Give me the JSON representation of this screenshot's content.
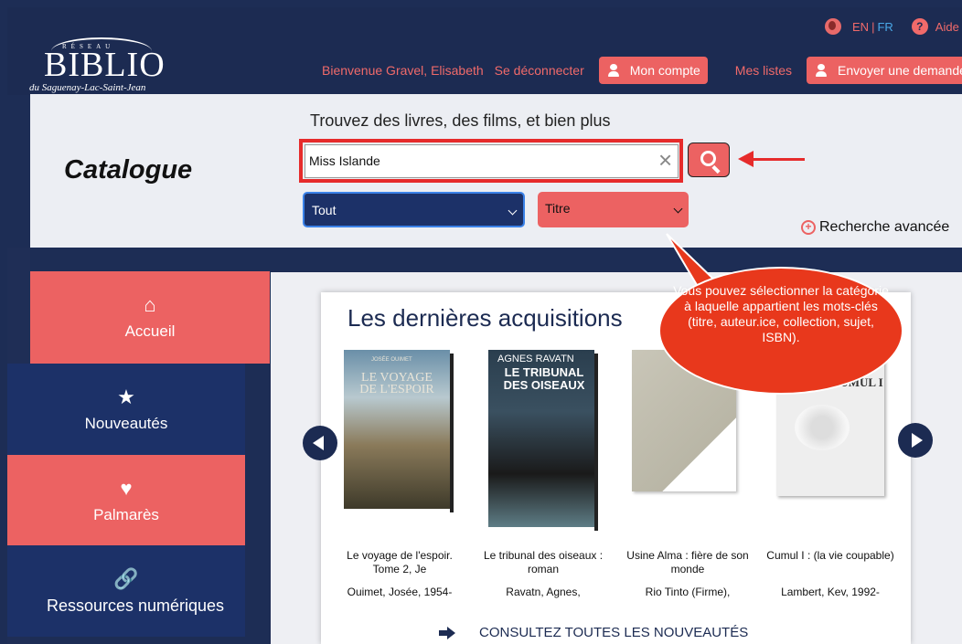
{
  "header": {
    "logo": {
      "reseau": "RÉSEAU",
      "name": "BIBLIO",
      "region": "du Saguenay-Lac-Saint-Jean"
    },
    "lang": {
      "en": "EN",
      "fr": "FR",
      "help": "Aide"
    },
    "welcome": "Bienvenue Gravel, Elisabeth",
    "logout": "Se déconnecter",
    "account": "Mon compte",
    "lists": "Mes listes",
    "request": "Envoyer une demande"
  },
  "search": {
    "page_title": "Catalogue",
    "tagline": "Trouvez des livres, des films, et bien plus",
    "query": "Miss Islande",
    "scope": "Tout",
    "field": "Titre",
    "advanced": "Recherche avancée"
  },
  "sidebar": {
    "items": [
      {
        "label": "Accueil",
        "icon": "home-icon"
      },
      {
        "label": "Nouveautés",
        "icon": "star-icon"
      },
      {
        "label": "Palmarès",
        "icon": "heart-icon"
      },
      {
        "label": "Ressources numériques",
        "icon": "link-icon"
      }
    ]
  },
  "acquisitions": {
    "title": "Les dernières acquisitions",
    "books": [
      {
        "title": "Le voyage de l'espoir. Tome 2, Je",
        "author": "Ouimet, Josée, 1954-",
        "cover_author": "JOSÉE OUIMET",
        "cover_title": "LE VOYAGE DE L'ESPOIR"
      },
      {
        "title": "Le tribunal des oiseaux : roman",
        "author": "Ravatn, Agnes,",
        "cover_author": "AGNES RAVATN",
        "cover_title": "LE TRIBUNAL DES OISEAUX"
      },
      {
        "title": "Usine Alma : fière de son monde",
        "author": "Rio Tinto (Firme),"
      },
      {
        "title": "Cumul I : (la vie coupable)",
        "author": "Lambert, Kev, 1992-",
        "cover_title": "CUMUL I"
      }
    ],
    "see_all": "CONSULTEZ TOUTES LES NOUVEAUTÉS"
  },
  "callout": {
    "text": "Vous pouvez sélectionner la catégorie à laquelle appartient les mots-clés (titre, auteur.ice, collection, sujet, ISBN)."
  },
  "colors": {
    "navy": "#1c2b52",
    "coral": "#ec6262",
    "annotation_red": "#e62b2b"
  }
}
